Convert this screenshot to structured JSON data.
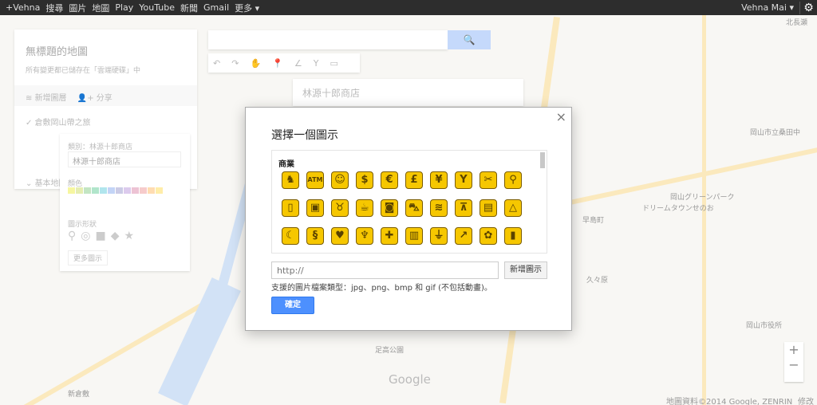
{
  "topbar": {
    "items": [
      "+Vehna",
      "搜尋",
      "圖片",
      "地圖",
      "Play",
      "YouTube",
      "新聞",
      "Gmail",
      "更多 ▾"
    ],
    "user": "Vehna Mai ▾",
    "gear_icon": "gear-icon"
  },
  "left_panel": {
    "title": "無標題的地圖",
    "saved": "所有變更都已儲存在「雲端硬碟」中",
    "add_layer": "新增圖層",
    "share": "分享",
    "layer_name": "倉敷岡山帶之旅",
    "base_map": "基本地圖"
  },
  "style_popup": {
    "label": "類別：林源十郎商店",
    "value": "林源十郎商店",
    "color_label": "顏色",
    "shape_label": "圖示形狀",
    "more_icons": "更多圖示"
  },
  "info_card": {
    "title": "林源十郎商店"
  },
  "dialog": {
    "title": "選擇一個圖示",
    "category": "商業",
    "icons": [
      "horse",
      "ATM",
      "baby",
      "dollar",
      "euro",
      "pound",
      "yen",
      "cocktail",
      "scissors",
      "cycling",
      "book",
      "briefcase",
      "cow",
      "coffee",
      "camera",
      "car",
      "car-wash",
      "car-lift",
      "film",
      "hanger",
      "moon",
      "money",
      "heart",
      "tooth",
      "first-aid",
      "bed",
      "plug",
      "chart",
      "flower",
      "bottles"
    ],
    "url_placeholder": "http://",
    "add_icon": "新增圖示",
    "help": "支援的圖片檔案類型：jpg、png、bmp 和 gif (不包括動畫)。",
    "ok": "確定",
    "close": "×"
  },
  "map": {
    "attribution": "地圖資料©2014 Google, ZENRIN",
    "edit": "修改",
    "zoom_in": "+",
    "zoom_out": "−",
    "watermark": "Google",
    "labels": [
      "北長瀬",
      "岡山市立桑田中",
      "岡山グリーンパーク",
      "ドリームタウンせのお",
      "久々原",
      "岡山市役所",
      "新倉敷",
      "足高公園",
      "早島町"
    ]
  },
  "colors": {
    "accent": "#4d90fe",
    "icon_fill": "#f6c700",
    "topbar": "#2d2d2d"
  }
}
